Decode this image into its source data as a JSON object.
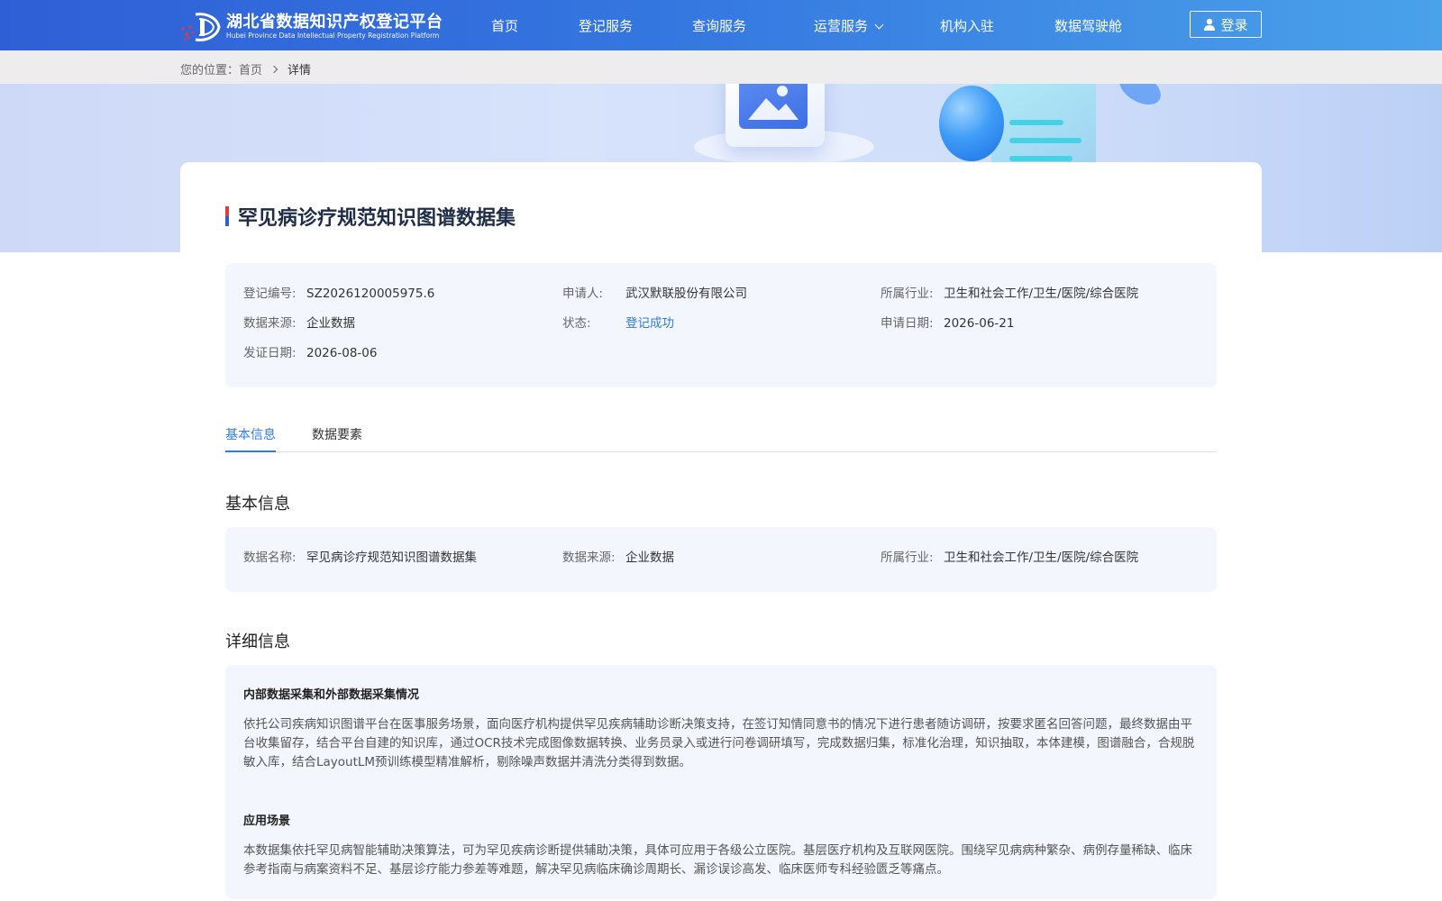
{
  "header": {
    "logo_cn": "湖北省数据知识产权登记平台",
    "logo_en": "Hubei Province Data Intellectual Property Registration Platform",
    "nav": [
      {
        "label": "首页"
      },
      {
        "label": "登记服务"
      },
      {
        "label": "查询服务"
      },
      {
        "label": "运营服务"
      },
      {
        "label": "机构入驻"
      },
      {
        "label": "数据驾驶舱"
      }
    ],
    "login_label": "登录"
  },
  "breadcrumb": {
    "prefix": "您的位置：",
    "home": "首页",
    "current": "详情"
  },
  "detail": {
    "title": "罕见病诊疗规范知识图谱数据集",
    "summary": {
      "reg_no_label": "登记编号:",
      "reg_no": "SZ2026120005975.6",
      "applicant_label": "申请人:",
      "applicant": "武汉默联股份有限公司",
      "industry_label": "所属行业:",
      "industry": "卫生和社会工作/卫生/医院/综合医院",
      "source_label": "数据来源:",
      "source": "企业数据",
      "status_label": "状态:",
      "status": "登记成功",
      "apply_date_label": "申请日期:",
      "apply_date": "2026-06-21",
      "issue_date_label": "发证日期:",
      "issue_date": "2026-08-06"
    },
    "tabs": [
      {
        "label": "基本信息"
      },
      {
        "label": "数据要素"
      }
    ],
    "basic": {
      "title": "基本信息",
      "name_label": "数据名称:",
      "name": "罕见病诊疗规范知识图谱数据集",
      "source_label": "数据来源:",
      "source": "企业数据",
      "industry_label": "所属行业:",
      "industry": "卫生和社会工作/卫生/医院/综合医院"
    },
    "more": {
      "title": "详细信息",
      "collect_title": "内部数据采集和外部数据采集情况",
      "collect_text": "依托公司疾病知识图谱平台在医事服务场景，面向医疗机构提供罕见疾病辅助诊断决策支持，在签订知情同意书的情况下进行患者随访调研，按要求匿名回答问题，最终数据由平台收集留存，结合平台自建的知识库，通过OCR技术完成图像数据转换、业务员录入或进行问卷调研填写，完成数据归集，标准化治理，知识抽取，本体建模，图谱融合，合规脱敏入库，结合LayoutLM预训练模型精准解析，剔除噪声数据并清洗分类得到数据。",
      "scene_title": "应用场景",
      "scene_text": "本数据集依托罕见病智能辅助决策算法，可为罕见疾病诊断提供辅助决策，具体可应用于各级公立医院。基层医疗机构及互联网医院。围绕罕见病病种繁杂、病例存量稀缺、临床参考指南与病案资料不足、基层诊疗能力参差等难题，解决罕见病临床确诊周期长、漏诊误诊高发、临床医师专科经验匮乏等痛点。"
    }
  }
}
